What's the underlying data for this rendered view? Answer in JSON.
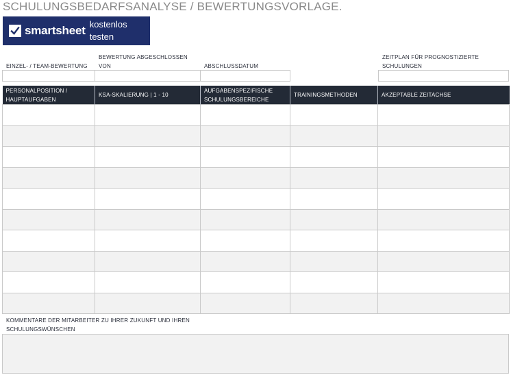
{
  "title": "SCHULUNGSBEDARFSANALYSE / BEWERTUNGSVORLAGE.",
  "banner": {
    "brand": "smartsheet",
    "cta": "kostenlos testen",
    "bg_color": "#1f2f6b"
  },
  "fields": {
    "assessment": {
      "label": "EINZEL- / TEAM-BEWERTUNG",
      "value": ""
    },
    "completed_by": {
      "label": "BEWERTUNG ABGESCHLOSSEN VON",
      "value": ""
    },
    "completion_date": {
      "label": "ABSCHLUSSDATUM",
      "value": ""
    },
    "schedule": {
      "label": "ZEITPLAN FÜR PROGNOSTIZIERTE SCHULUNGEN",
      "value": ""
    }
  },
  "table": {
    "header_color": "#232a36",
    "columns": [
      "PERSONALPOSITION / HAUPTAUFGABEN",
      "KSA-SKALIERUNG | 1 - 10",
      "AUFGABENSPEZIFISCHE SCHULUNGSBEREICHE",
      "TRAININGSMETHODEN",
      "AKZEPTABLE ZEITACHSE"
    ],
    "rows": [
      [
        "",
        "",
        "",
        "",
        ""
      ],
      [
        "",
        "",
        "",
        "",
        ""
      ],
      [
        "",
        "",
        "",
        "",
        ""
      ],
      [
        "",
        "",
        "",
        "",
        ""
      ],
      [
        "",
        "",
        "",
        "",
        ""
      ],
      [
        "",
        "",
        "",
        "",
        ""
      ],
      [
        "",
        "",
        "",
        "",
        ""
      ],
      [
        "",
        "",
        "",
        "",
        ""
      ],
      [
        "",
        "",
        "",
        "",
        ""
      ],
      [
        "",
        "",
        "",
        "",
        ""
      ]
    ]
  },
  "comments": {
    "label": "KOMMENTARE DER MITARBEITER ZU IHRER ZUKUNFT UND IHREN SCHULUNGSWÜNSCHEN",
    "value": ""
  }
}
